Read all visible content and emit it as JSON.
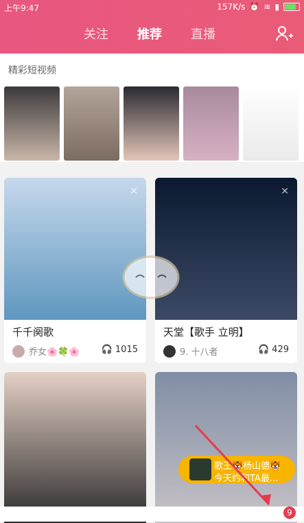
{
  "status": {
    "time": "上午9:47",
    "speed": "157K/s"
  },
  "tabs": [
    "关注",
    "推荐",
    "直播"
  ],
  "section": {
    "title": "精彩短视频"
  },
  "cards": [
    {
      "title": "千千阕歌",
      "author": "乔女🌸🍀🌸",
      "count": "1015"
    },
    {
      "title": "天堂【歌手 立明】",
      "author": "9. 十八者",
      "count": "429"
    }
  ],
  "live": {
    "line1": "歌王🐯杨山德🐯",
    "line2": "今天约和TA最..."
  },
  "badge": "9",
  "colors": {
    "brand": "#e8577f",
    "badge": "#e53b4e",
    "live": "#f7b400"
  }
}
